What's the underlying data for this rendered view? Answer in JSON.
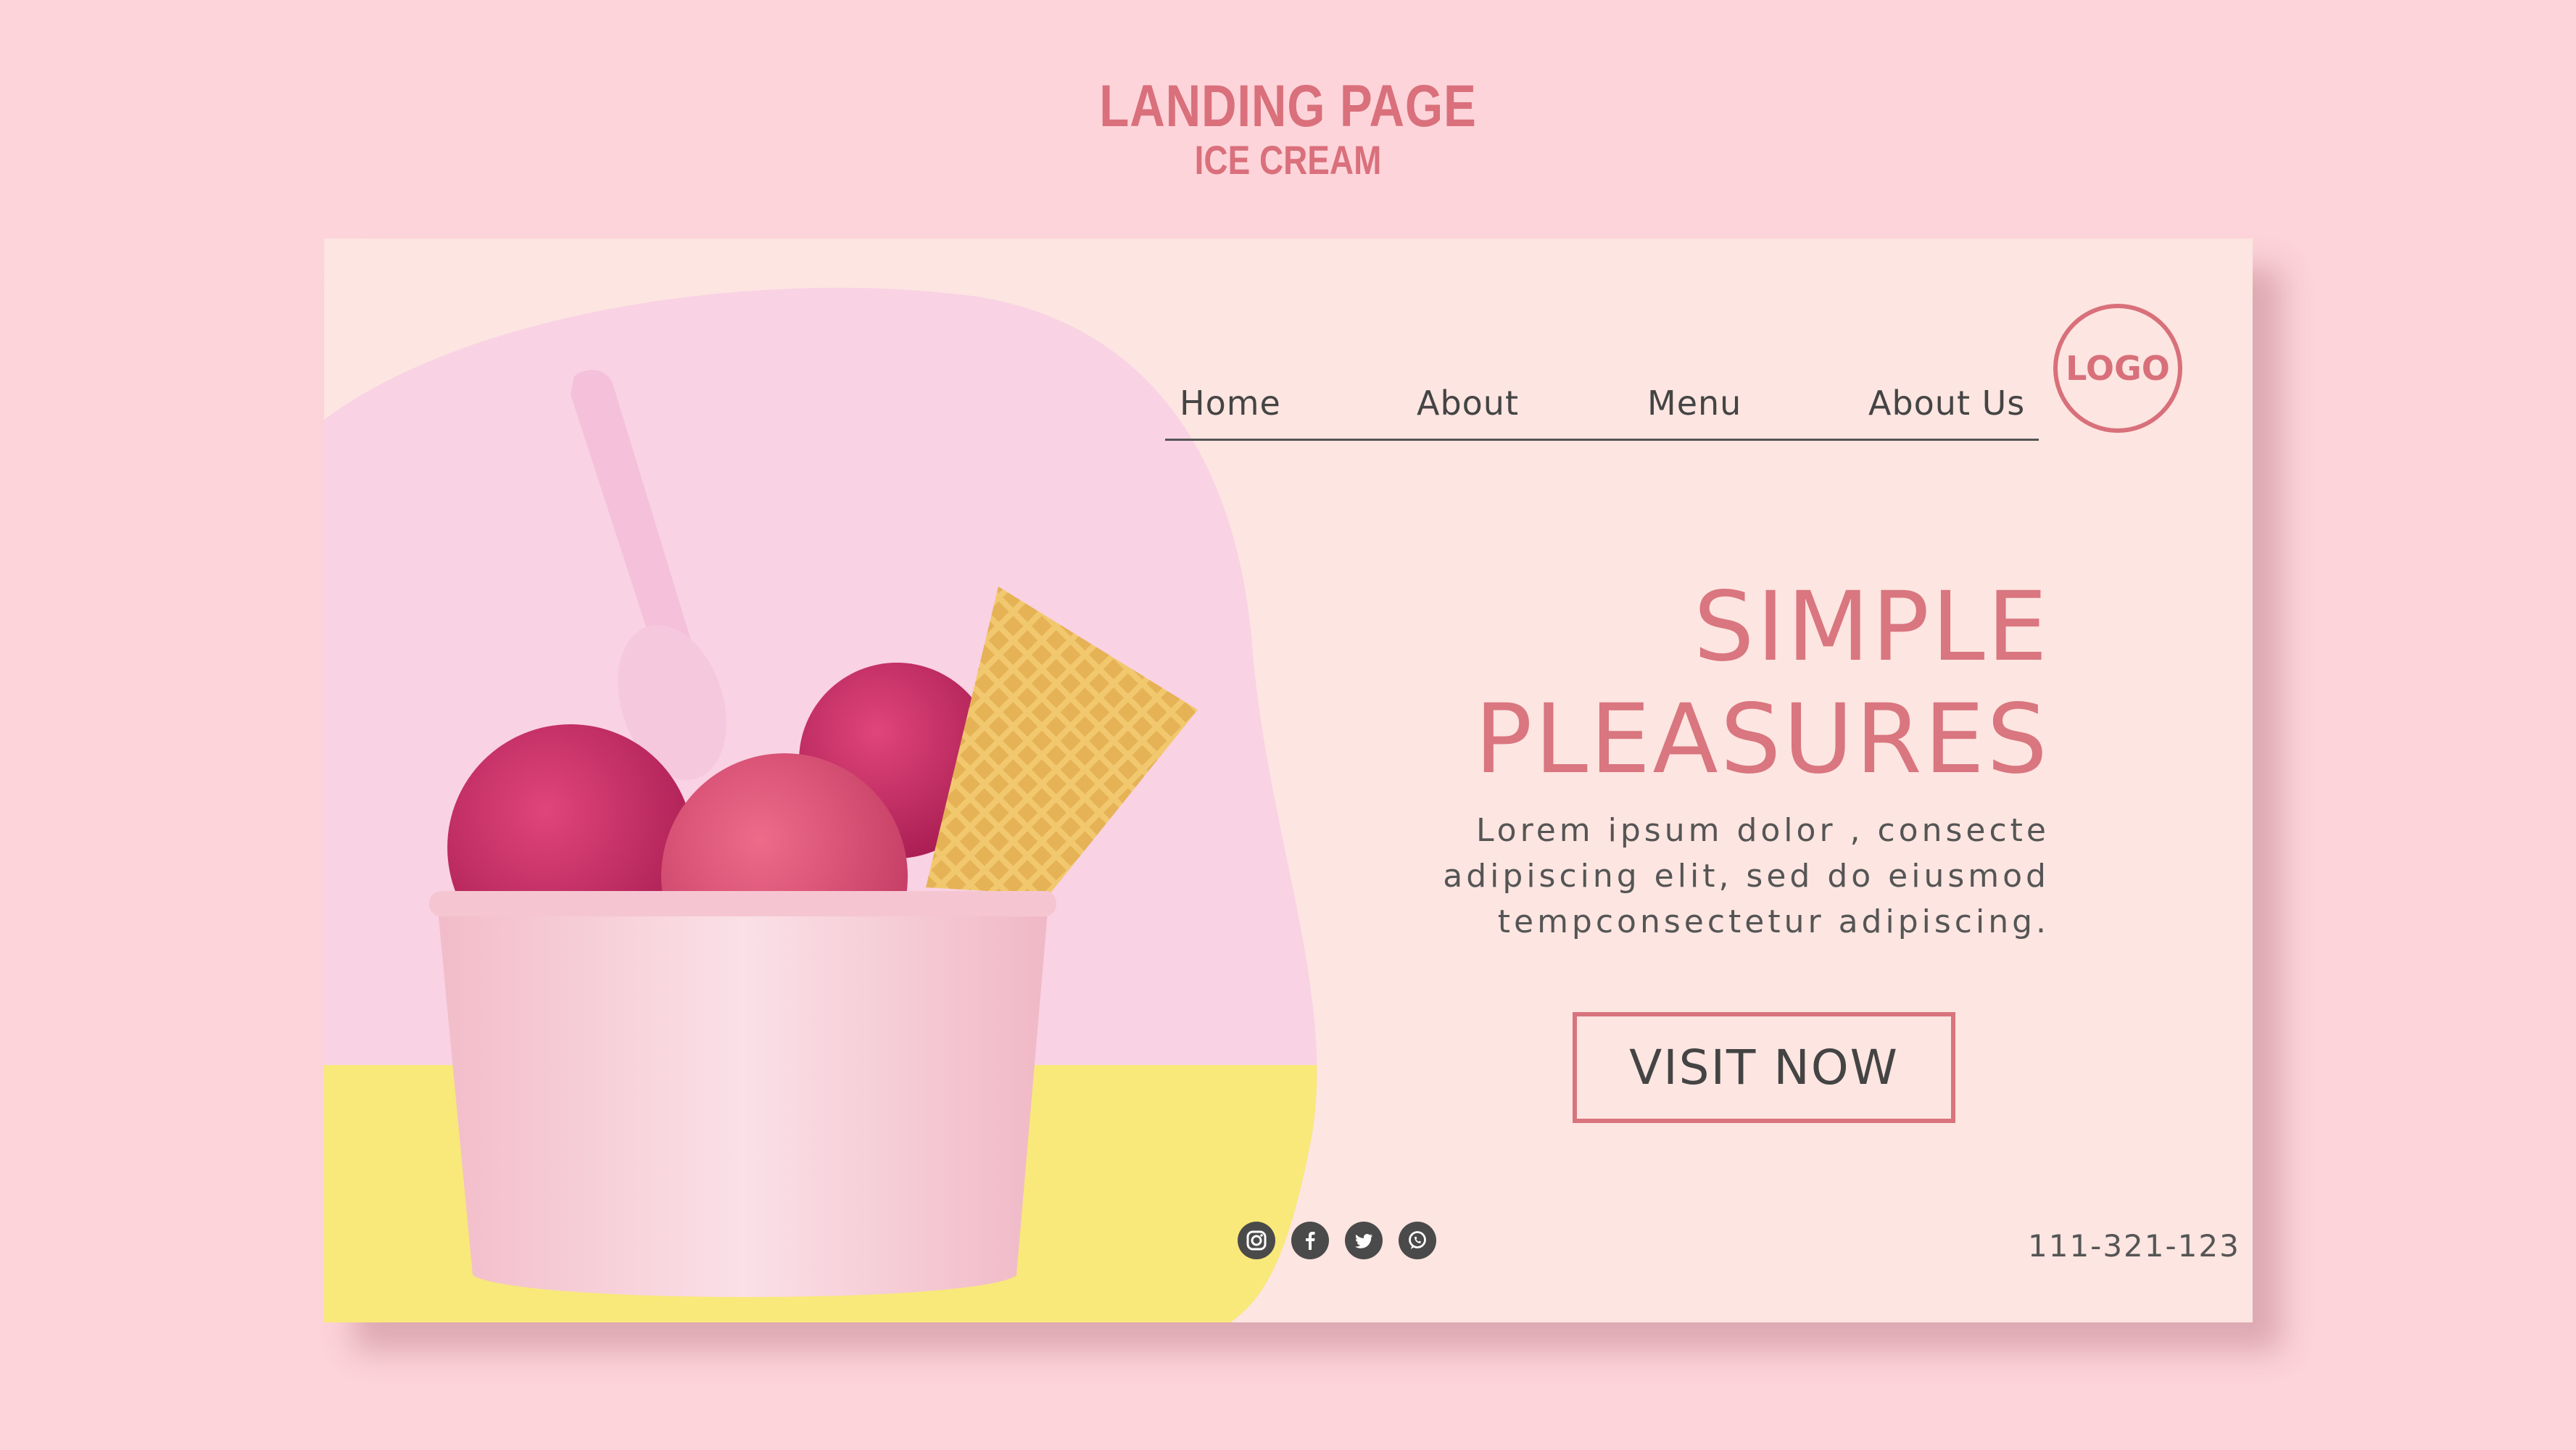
{
  "header": {
    "title": "LANDING PAGE",
    "subtitle": "ICE CREAM"
  },
  "nav": {
    "items": [
      "Home",
      "About",
      "Menu",
      "About Us"
    ]
  },
  "logo": {
    "label": "LOGO"
  },
  "hero": {
    "headline_line1": "SIMPLE",
    "headline_line2": "PLEASURES",
    "body_lines": [
      "Lorem ipsum dolor , consecte",
      "adipiscing elit, sed do eiusmod",
      "tempconsectetur adipiscing."
    ],
    "cta_label": "VISIT NOW"
  },
  "social_icons": [
    "instagram-icon",
    "facebook-icon",
    "twitter-icon",
    "whatsapp-icon"
  ],
  "footer": {
    "phone": "111-321-123"
  },
  "colors": {
    "page_bg": "#fdd4da",
    "card_bg": "#fde5e1",
    "accent": "#d9707b",
    "text_dark": "#444444"
  }
}
